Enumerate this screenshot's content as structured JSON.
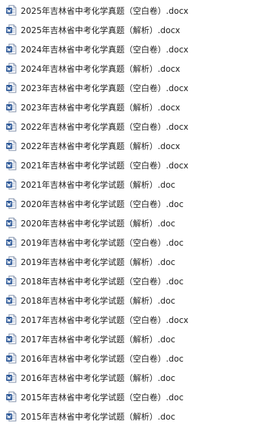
{
  "files": [
    {
      "name": "2025年吉林省中考化学真题（空白卷）.docx",
      "icon": "word-document-icon"
    },
    {
      "name": "2025年吉林省中考化学真题（解析）.docx",
      "icon": "word-document-icon"
    },
    {
      "name": "2024年吉林省中考化学真题（空白卷）.docx",
      "icon": "word-document-icon"
    },
    {
      "name": "2024年吉林省中考化学真题（解析）.docx",
      "icon": "word-document-icon"
    },
    {
      "name": "2023年吉林省中考化学真题（空白卷）.docx",
      "icon": "word-document-icon"
    },
    {
      "name": "2023年吉林省中考化学真题（解析）.docx",
      "icon": "word-document-icon"
    },
    {
      "name": "2022年吉林省中考化学真题（空白卷）.docx",
      "icon": "word-document-icon"
    },
    {
      "name": "2022年吉林省中考化学真题（解析）.docx",
      "icon": "word-document-icon"
    },
    {
      "name": "2021年吉林省中考化学试题（空白卷）.docx",
      "icon": "word-document-icon"
    },
    {
      "name": "2021年吉林省中考化学试题（解析）.doc",
      "icon": "word-document-icon"
    },
    {
      "name": "2020年吉林省中考化学试题（空白卷）.doc",
      "icon": "word-document-icon"
    },
    {
      "name": "2020年吉林省中考化学试题（解析）.doc",
      "icon": "word-document-icon"
    },
    {
      "name": "2019年吉林省中考化学试题（空白卷）.doc",
      "icon": "word-document-icon"
    },
    {
      "name": "2019年吉林省中考化学试题（解析）.doc",
      "icon": "word-document-icon"
    },
    {
      "name": "2018年吉林省中考化学试题（空白卷）.doc",
      "icon": "word-document-icon"
    },
    {
      "name": "2018年吉林省中考化学试题（解析）.doc",
      "icon": "word-document-icon"
    },
    {
      "name": "2017年吉林省中考化学试题（空白卷）.docx",
      "icon": "word-document-icon"
    },
    {
      "name": "2017年吉林省中考化学试题（解析）.doc",
      "icon": "word-document-icon"
    },
    {
      "name": "2016年吉林省中考化学试题（空白卷）.doc",
      "icon": "word-document-icon"
    },
    {
      "name": "2016年吉林省中考化学试题（解析）.doc",
      "icon": "word-document-icon"
    },
    {
      "name": "2015年吉林省中考化学试题（空白卷）.doc",
      "icon": "word-document-icon"
    },
    {
      "name": "2015年吉林省中考化学试题（解析）.doc",
      "icon": "word-document-icon"
    }
  ],
  "colors": {
    "icon_blue": "#2b5797",
    "icon_page": "#ffffff",
    "text": "#1e1e1e"
  }
}
